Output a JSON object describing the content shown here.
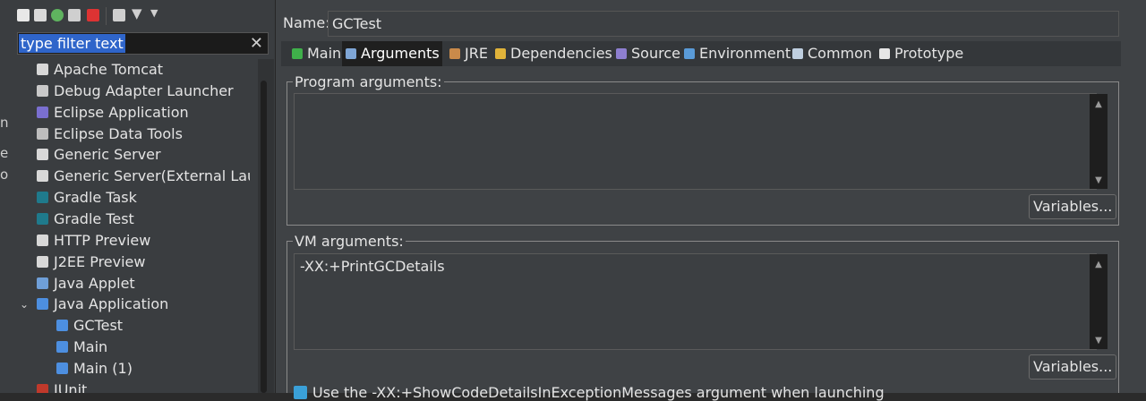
{
  "left_panel": {
    "filter": {
      "value": "type filter text",
      "clear_icon": "close-icon"
    },
    "tree": [
      {
        "label": "Apache Tomcat",
        "icon": "server-icon",
        "depth": 0
      },
      {
        "label": "Debug Adapter Launcher",
        "icon": "debug-adapter-icon",
        "depth": 0
      },
      {
        "label": "Eclipse Application",
        "icon": "eclipse-app-icon",
        "depth": 0
      },
      {
        "label": "Eclipse Data Tools",
        "icon": "data-tools-icon",
        "depth": 0
      },
      {
        "label": "Generic Server",
        "icon": "server-icon",
        "depth": 0
      },
      {
        "label": "Generic Server(External Launc",
        "icon": "server-icon",
        "depth": 0
      },
      {
        "label": "Gradle Task",
        "icon": "gradle-icon",
        "depth": 0
      },
      {
        "label": "Gradle Test",
        "icon": "gradle-icon",
        "depth": 0
      },
      {
        "label": "HTTP Preview",
        "icon": "server-icon",
        "depth": 0
      },
      {
        "label": "J2EE Preview",
        "icon": "server-icon",
        "depth": 0
      },
      {
        "label": "Java Applet",
        "icon": "applet-icon",
        "depth": 0
      },
      {
        "label": "Java Application",
        "icon": "java-app-icon",
        "depth": 0,
        "expanded": true
      },
      {
        "label": "GCTest",
        "icon": "java-app-icon",
        "depth": 1
      },
      {
        "label": "Main",
        "icon": "java-app-icon",
        "depth": 1
      },
      {
        "label": "Main (1)",
        "icon": "java-app-icon",
        "depth": 1
      },
      {
        "label": "JUnit",
        "icon": "junit-icon",
        "depth": 0
      }
    ]
  },
  "config": {
    "name_label": "Name:",
    "name_value": "GCTest",
    "tabs": [
      {
        "label": "Main",
        "icon": "main-tab-icon",
        "active": false
      },
      {
        "label": "Arguments",
        "icon": "arguments-tab-icon",
        "active": true
      },
      {
        "label": "JRE",
        "icon": "jre-tab-icon",
        "active": false
      },
      {
        "label": "Dependencies",
        "icon": "dependencies-tab-icon",
        "active": false
      },
      {
        "label": "Source",
        "icon": "source-tab-icon",
        "active": false
      },
      {
        "label": "Environment",
        "icon": "environment-tab-icon",
        "active": false
      },
      {
        "label": "Common",
        "icon": "common-tab-icon",
        "active": false
      },
      {
        "label": "Prototype",
        "icon": "prototype-tab-icon",
        "active": false
      }
    ],
    "program_arguments": {
      "label": "Program arguments:",
      "value": "",
      "variables_button": "Variables..."
    },
    "vm_arguments": {
      "label": "VM arguments:",
      "value": "-XX:+PrintGCDetails",
      "variables_button": "Variables..."
    },
    "checkbox_label": "Use the -XX:+ShowCodeDetailsInExceptionMessages argument when launching"
  },
  "colors": {
    "accent": "#2f65ca",
    "active_tab_bg": "#1f1f1f",
    "checkbox": "#3aa0d8"
  }
}
